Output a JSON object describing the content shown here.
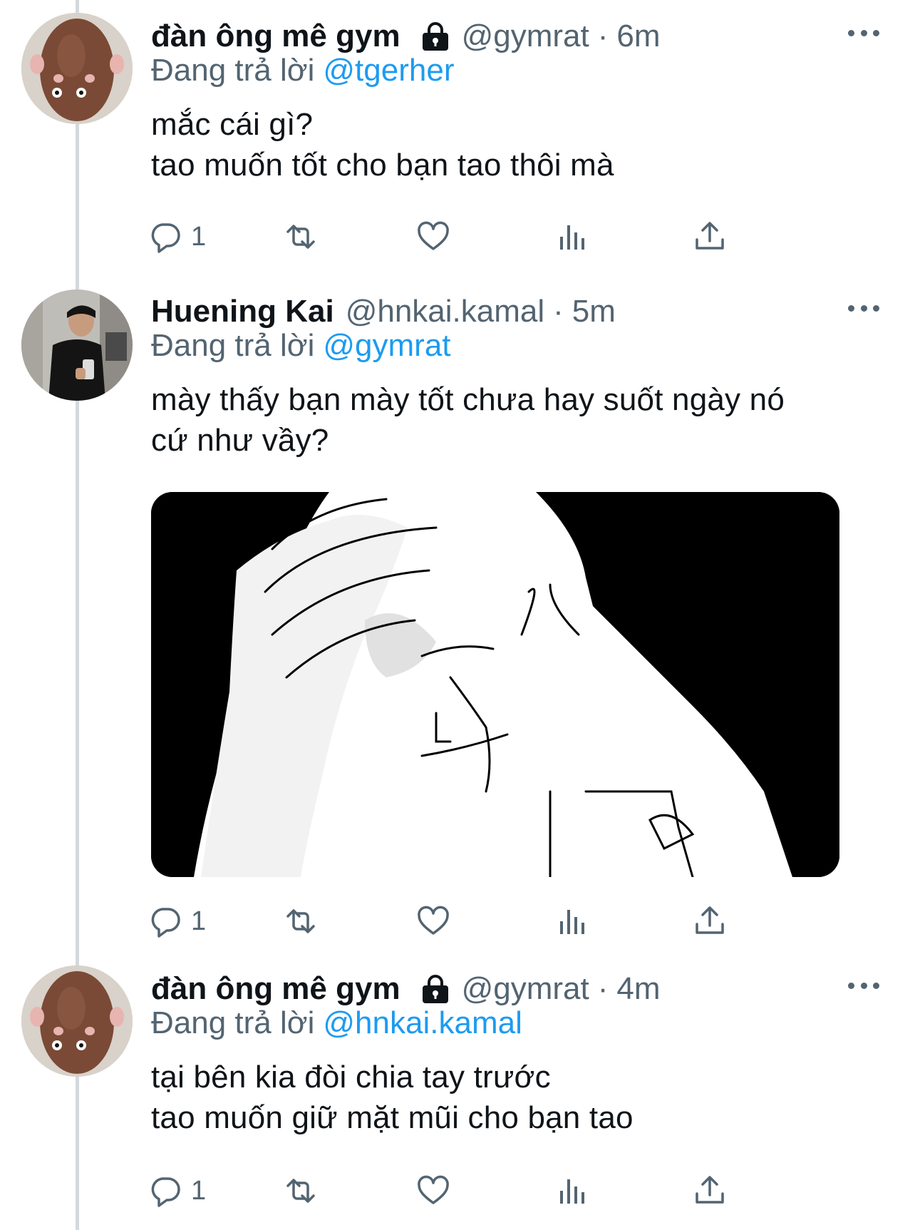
{
  "tweets": [
    {
      "name": "đàn ông mê gym",
      "locked": true,
      "handle": "@gymrat",
      "sep": "·",
      "time": "6m",
      "reply_prefix": "Đang trả lời",
      "reply_to": "@tgerher",
      "text_lines": [
        "mắc cái gì?",
        "tao muốn tốt cho bạn tao thôi mà"
      ],
      "reply_count": "1"
    },
    {
      "name": "Huening Kai",
      "locked": false,
      "handle": "@hnkai.kamal",
      "sep": "·",
      "time": "5m",
      "reply_prefix": "Đang trả lời",
      "reply_to": "@gymrat",
      "text_lines": [
        "mày thấy bạn mày tốt chưa hay suốt ngày nó",
        "cứ như vầy?"
      ],
      "has_media": true,
      "reply_count": "1"
    },
    {
      "name": "đàn ông mê gym",
      "locked": true,
      "handle": "@gymrat",
      "sep": "·",
      "time": "4m",
      "reply_prefix": "Đang trả lời",
      "reply_to": "@hnkai.kamal",
      "text_lines": [
        "tại bên kia đòi chia tay trước",
        "tao muốn giữ mặt mũi cho bạn tao"
      ],
      "reply_count": "1"
    }
  ],
  "icons": {
    "reply": "reply-icon",
    "retweet": "retweet-icon",
    "like": "heart-icon",
    "views": "analytics-icon",
    "share": "share-icon",
    "more": "more-icon",
    "lock": "lock-icon"
  },
  "colors": {
    "link": "#1d9bf0",
    "secondary": "#536471",
    "thread_line": "#d4d9dd"
  }
}
